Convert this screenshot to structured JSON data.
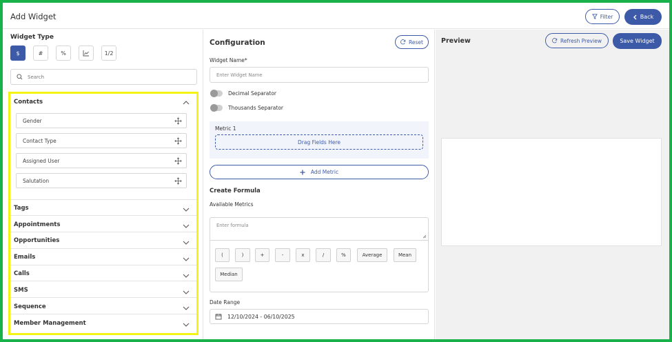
{
  "header": {
    "title": "Add Widget",
    "filter_label": "Filter",
    "back_label": "Back"
  },
  "left": {
    "widget_type_label": "Widget Type",
    "widget_types": [
      "$",
      "#",
      "%",
      "chart-icon",
      "1/2"
    ],
    "search_placeholder": "Search",
    "sections": [
      {
        "name": "Contacts",
        "expanded": true,
        "fields": [
          "Gender",
          "Contact Type",
          "Assigned User",
          "Salutation"
        ]
      },
      {
        "name": "Tags"
      },
      {
        "name": "Appointments"
      },
      {
        "name": "Opportunities"
      },
      {
        "name": "Emails"
      },
      {
        "name": "Calls"
      },
      {
        "name": "SMS"
      },
      {
        "name": "Sequence"
      },
      {
        "name": "Member Management"
      }
    ]
  },
  "config": {
    "title": "Configuration",
    "reset_label": "Reset",
    "widget_name_label": "Widget Name*",
    "widget_name_placeholder": "Enter Widget Name",
    "decimal_separator_label": "Decimal Separator",
    "thousands_separator_label": "Thousands Separator",
    "metric_title": "Metric 1",
    "drag_label": "Drag Fields Here",
    "add_metric_label": "Add Metric",
    "create_formula_label": "Create Formula",
    "available_metrics_label": "Available Metrics",
    "formula_placeholder": "Enter formula",
    "operators": [
      "(",
      ")",
      "+",
      "-",
      "x",
      "/",
      "%",
      "Average",
      "Mean",
      "Median"
    ],
    "date_range_label": "Date Range",
    "date_range_value": "12/10/2024 - 06/10/2025"
  },
  "preview": {
    "title": "Preview",
    "refresh_label": "Refresh Preview",
    "save_label": "Save Widget"
  },
  "colors": {
    "accent": "#3d5aa8",
    "frame_outline": "#19b24a",
    "highlight_outline": "#f3f314"
  }
}
